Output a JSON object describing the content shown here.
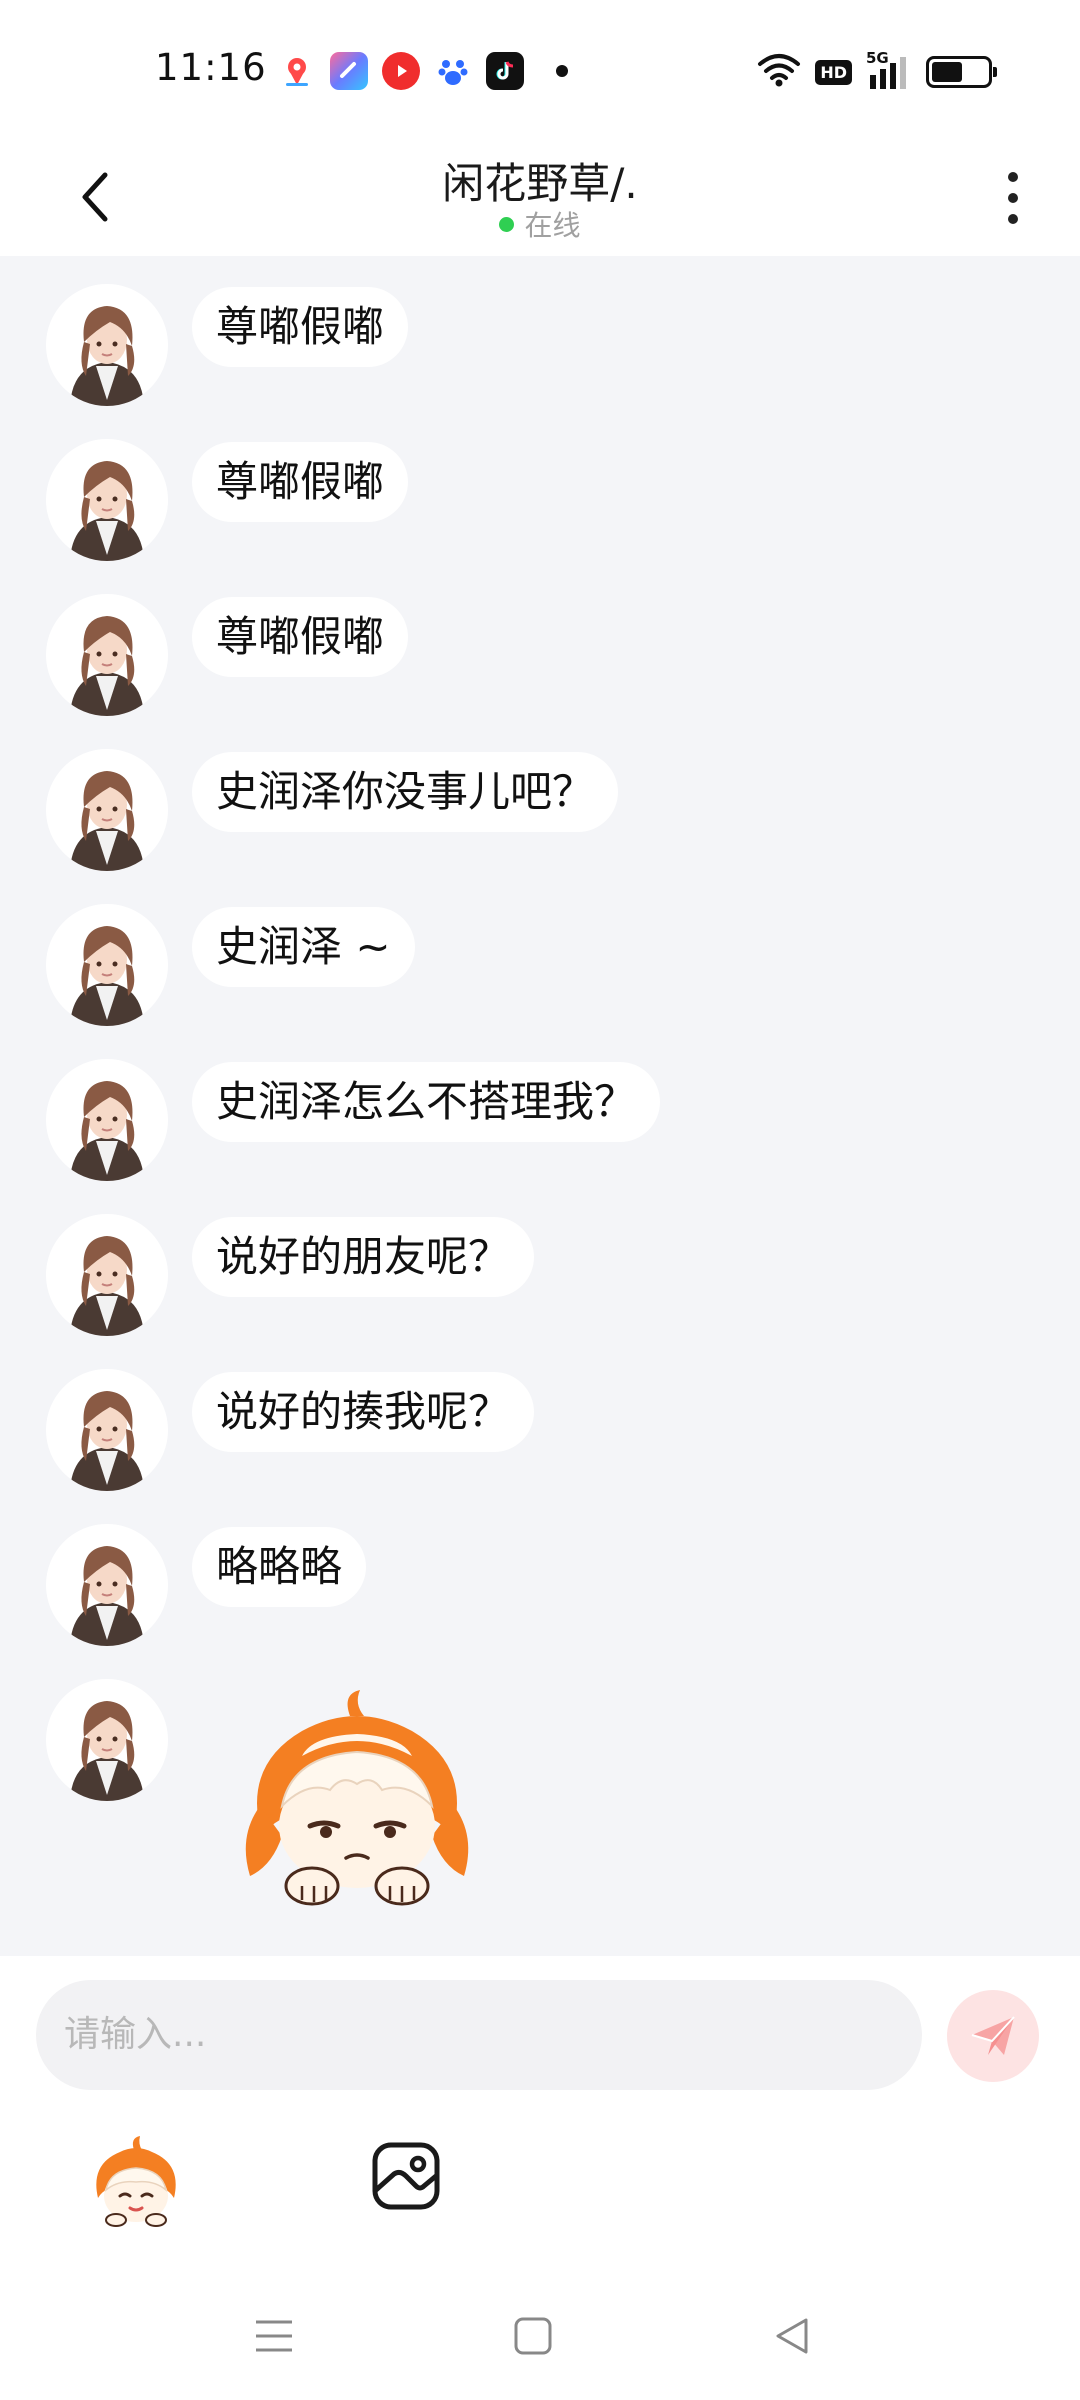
{
  "status_bar": {
    "time": "11:16",
    "icons": [
      "map-app-icon",
      "photo-app-icon",
      "video-app-icon",
      "baidu-app-icon",
      "tiktok-app-icon",
      "more-notifications-dot"
    ],
    "system": [
      "wifi-icon",
      "hd-badge",
      "signal-5g-icon",
      "battery-icon"
    ],
    "hd_label": "HD",
    "network_label": "5G",
    "battery_level": 0.55
  },
  "header": {
    "title": "闲花野草/.",
    "status": "在线",
    "status_color": "#2fcf52"
  },
  "messages": [
    {
      "text": "尊嘟假嘟"
    },
    {
      "text": "尊嘟假嘟"
    },
    {
      "text": "尊嘟假嘟"
    },
    {
      "text": "史润泽你没事儿吧？"
    },
    {
      "text": "史润泽 ~"
    },
    {
      "text": "史润泽怎么不搭理我？"
    },
    {
      "text": "说好的朋友呢？"
    },
    {
      "text": "说好的揍我呢？"
    },
    {
      "text": "略略略"
    }
  ],
  "sticker": {
    "icon": "orange-hair-character-sticker"
  },
  "input": {
    "placeholder": "请输入..."
  },
  "colors": {
    "chat_background": "#f4f5f8",
    "send_button": "#fde3e3",
    "send_icon": "#f7a4a4"
  }
}
